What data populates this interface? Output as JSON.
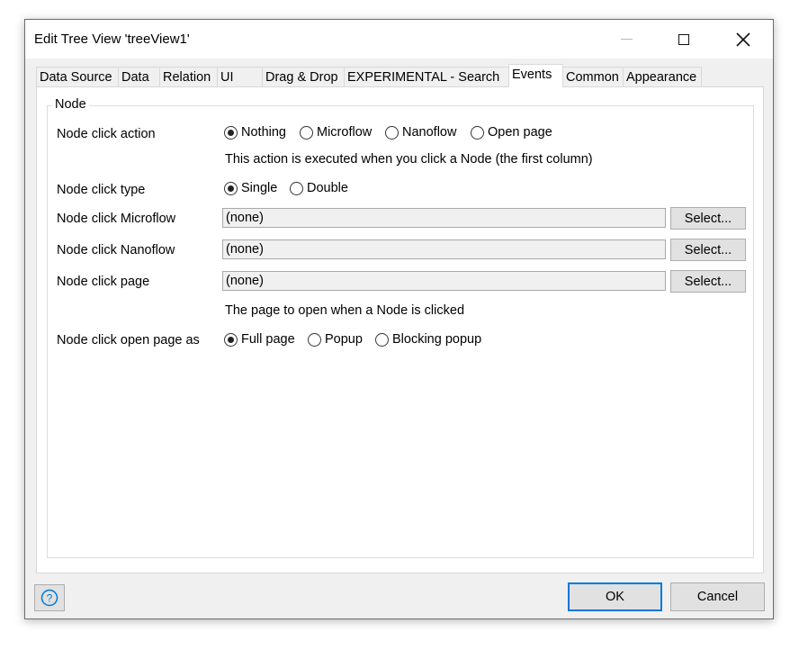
{
  "window": {
    "title": "Edit Tree View 'treeView1'"
  },
  "tabs": [
    {
      "label": "Data Source"
    },
    {
      "label": "Data"
    },
    {
      "label": "Relation"
    },
    {
      "label": "UI"
    },
    {
      "label": "Drag & Drop"
    },
    {
      "label": "EXPERIMENTAL - Search"
    },
    {
      "label": "Events",
      "active": true
    },
    {
      "label": "Common"
    },
    {
      "label": "Appearance"
    }
  ],
  "group": {
    "legend": "Node",
    "click_action": {
      "label": "Node click action",
      "options": [
        "Nothing",
        "Microflow",
        "Nanoflow",
        "Open page"
      ],
      "selected": "Nothing",
      "hint": "This action is executed when you click a Node (the first column)"
    },
    "click_type": {
      "label": "Node click type",
      "options": [
        "Single",
        "Double"
      ],
      "selected": "Single"
    },
    "click_microflow": {
      "label": "Node click Microflow",
      "value": "(none)",
      "button": "Select..."
    },
    "click_nanoflow": {
      "label": "Node click Nanoflow",
      "value": "(none)",
      "button": "Select..."
    },
    "click_page": {
      "label": "Node click page",
      "value": "(none)",
      "button": "Select...",
      "hint": "The page to open when a Node is clicked"
    },
    "open_page_as": {
      "label": "Node click open page as",
      "options": [
        "Full page",
        "Popup",
        "Blocking popup"
      ],
      "selected": "Full page"
    }
  },
  "footer": {
    "help_icon": "question-circle-icon",
    "ok": "OK",
    "cancel": "Cancel"
  },
  "colors": {
    "accent": "#0078d7",
    "dialog_bg": "#f0f0f0"
  }
}
